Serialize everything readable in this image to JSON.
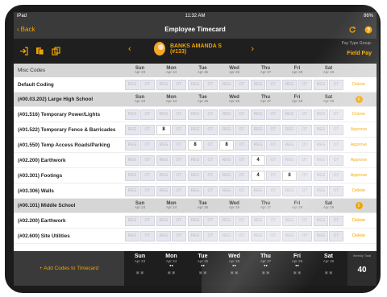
{
  "status": {
    "carrier": "iPad",
    "time": "11:32 AM",
    "battery": "86%"
  },
  "nav": {
    "back_label": "Back",
    "title": "Employee Timecard"
  },
  "employee": {
    "name": "BANKS AMANDA S (#133)",
    "prev_icon": "chevron-left",
    "next_icon": "chevron-right"
  },
  "paytype": {
    "label": "Pay Type Group:",
    "value": "Field Pay"
  },
  "header": {
    "label": "Misc Codes"
  },
  "days": [
    {
      "day": "Sun",
      "date": "Apr 23"
    },
    {
      "day": "Mon",
      "date": "Apr 24"
    },
    {
      "day": "Tue",
      "date": "Apr 25"
    },
    {
      "day": "Wed",
      "date": "Apr 26"
    },
    {
      "day": "Thu",
      "date": "Apr 27"
    },
    {
      "day": "Fri",
      "date": "Apr 28"
    },
    {
      "day": "Sat",
      "date": "Apr 29"
    }
  ],
  "cell_placeholders": [
    "REG",
    "OT"
  ],
  "rows": [
    {
      "type": "code",
      "code": "Default Coding",
      "values": [
        "",
        "",
        "",
        "",
        "",
        "",
        ""
      ],
      "action": "Delete"
    },
    {
      "type": "group",
      "code": "(#00.03.202) Large High School"
    },
    {
      "type": "code",
      "code": "(#01.516) Temporary Power/Lights",
      "values": [
        "",
        "",
        "",
        "",
        "",
        "",
        ""
      ],
      "action": "Delete"
    },
    {
      "type": "code",
      "code": "(#01.522) Temporary Fence & Barricades",
      "values": [
        "",
        "8",
        "",
        "",
        "",
        "",
        ""
      ],
      "action": "Approve"
    },
    {
      "type": "code",
      "code": "(#01.550) Temp Access Roads/Parking",
      "values": [
        "",
        "",
        "8",
        "8",
        "",
        "",
        ""
      ],
      "action": "Approve"
    },
    {
      "type": "code",
      "code": "(#02.200) Earthwork",
      "values": [
        "",
        "",
        "",
        "",
        "4",
        "",
        ""
      ],
      "action": "Approve"
    },
    {
      "type": "code",
      "code": "(#03.301) Footings",
      "values": [
        "",
        "",
        "",
        "",
        "4",
        "8",
        ""
      ],
      "action": "Approve"
    },
    {
      "type": "code",
      "code": "(#03.306) Walls",
      "values": [
        "",
        "",
        "",
        "",
        "",
        "",
        ""
      ],
      "action": "Delete"
    },
    {
      "type": "group",
      "code": "(#00.101) Middle School"
    },
    {
      "type": "code",
      "code": "(#02.200) Earthwork",
      "values": [
        "",
        "",
        "",
        "",
        "",
        "",
        ""
      ],
      "action": "Delete"
    },
    {
      "type": "code",
      "code": "(#02.600) Site Utilities",
      "values": [
        "",
        "",
        "",
        "",
        "",
        "",
        ""
      ],
      "action": "Delete"
    }
  ],
  "footer": {
    "add_label": "+ Add Codes to Timecard",
    "weekly_label": "Weekly Total",
    "weekly_total": "40"
  },
  "colors": {
    "accent": "#f0a400",
    "header_bg": "#3a3a3a",
    "toolbar_bg": "#1f1f1f"
  }
}
